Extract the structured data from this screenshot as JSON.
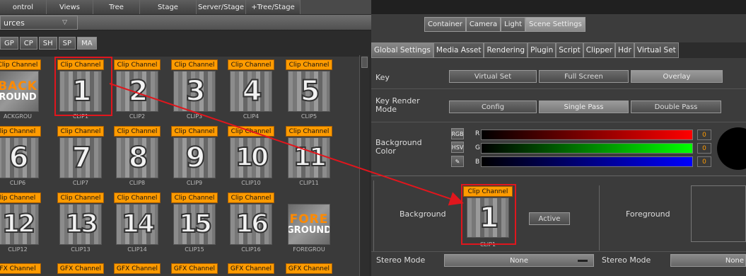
{
  "nav": {
    "tabs": [
      "ontrol",
      "Views",
      "Tree",
      "Stage",
      "Server/Stage",
      "+Tree/Stage"
    ]
  },
  "sources": {
    "label": "urces"
  },
  "subtabs": [
    "GP",
    "CP",
    "SH",
    "SP",
    "MA"
  ],
  "tiles": [
    {
      "tag": "Clip Channel",
      "num": "",
      "cap": "ACKGROU",
      "special": [
        "BACK",
        "ROUND"
      ]
    },
    {
      "tag": "Clip Channel",
      "num": "1",
      "cap": "CLIP1"
    },
    {
      "tag": "Clip Channel",
      "num": "2",
      "cap": "CLIP2"
    },
    {
      "tag": "Clip Channel",
      "num": "3",
      "cap": "CLIP3"
    },
    {
      "tag": "Clip Channel",
      "num": "4",
      "cap": "CLIP4"
    },
    {
      "tag": "Clip Channel",
      "num": "5",
      "cap": "CLIP5"
    },
    {
      "tag": "lip Channel",
      "num": "6",
      "cap": "CLIP6"
    },
    {
      "tag": "Clip Channel",
      "num": "7",
      "cap": "CLIP7"
    },
    {
      "tag": "Clip Channel",
      "num": "8",
      "cap": "CLIP8"
    },
    {
      "tag": "Clip Channel",
      "num": "9",
      "cap": "CLIP9"
    },
    {
      "tag": "Clip Channel",
      "num": "10",
      "cap": "CLIP10"
    },
    {
      "tag": "Clip Channel",
      "num": "11",
      "cap": "CLIP11"
    },
    {
      "tag": "lip Channel",
      "num": "12",
      "cap": "CLIP12"
    },
    {
      "tag": "Clip Channel",
      "num": "13",
      "cap": "CLIP13"
    },
    {
      "tag": "Clip Channel",
      "num": "14",
      "cap": "CLIP14"
    },
    {
      "tag": "Clip Channel",
      "num": "15",
      "cap": "CLIP15"
    },
    {
      "tag": "Clip Channel",
      "num": "16",
      "cap": "CLIP16"
    },
    {
      "tag": "",
      "num": "",
      "cap": "FOREGROU",
      "special": [
        "FORE",
        "GROUND"
      ]
    },
    {
      "tag": "FX Channel",
      "num": "",
      "cap": ""
    },
    {
      "tag": "GFX Channel",
      "num": "",
      "cap": ""
    },
    {
      "tag": "GFX Channel",
      "num": "",
      "cap": ""
    },
    {
      "tag": "GFX Channel",
      "num": "",
      "cap": ""
    },
    {
      "tag": "GFX Channel",
      "num": "",
      "cap": ""
    },
    {
      "tag": "GFX Channel",
      "num": "",
      "cap": ""
    }
  ],
  "right": {
    "toptabs": [
      "Container",
      "Camera",
      "Light",
      "Scene Settings"
    ],
    "settabs": [
      "Global Settings",
      "Media Asset",
      "Rendering",
      "Plugin",
      "Script",
      "Clipper",
      "Hdr",
      "Virtual Set"
    ],
    "key_label": "Key",
    "key_buttons": [
      "Virtual Set",
      "Full Screen",
      "Overlay"
    ],
    "krm_label": "Key Render Mode",
    "krm_buttons": [
      "Config",
      "Single Pass",
      "Double Pass"
    ],
    "bg_color_label": "Background Color",
    "rgb": "RGB",
    "hsv": "HSV",
    "channels": [
      "R",
      "G",
      "B"
    ],
    "values": [
      "0",
      "0",
      "0"
    ],
    "colors": {
      "swatch": "#000000",
      "accent": "#ff9b00",
      "highlight": "#e0161d"
    },
    "background_label": "Background",
    "bg_tag": "Clip Channel",
    "bg_num": "1",
    "bg_cap": "CLIP1",
    "active_btn": "Active",
    "foreground_label": "Foreground",
    "stereo_label": "Stereo Mode",
    "stereo_value": "None",
    "stereo_label2": "Stereo Mode",
    "stereo_value2": "None"
  }
}
